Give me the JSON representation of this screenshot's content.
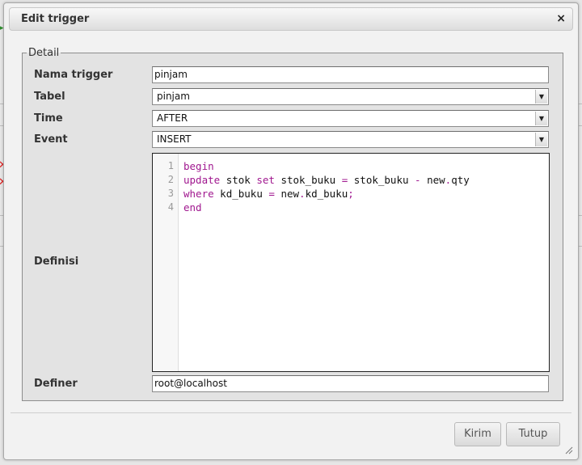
{
  "dialog": {
    "title": "Edit trigger",
    "close_symbol": "×"
  },
  "detail": {
    "legend": "Detail",
    "fields": {
      "name": {
        "label": "Nama trigger",
        "value": "pinjam"
      },
      "table": {
        "label": "Tabel",
        "value": "pinjam"
      },
      "time": {
        "label": "Time",
        "value": "AFTER"
      },
      "event": {
        "label": "Event",
        "value": "INSERT"
      },
      "definition": {
        "label": "Definisi"
      },
      "definer": {
        "label": "Definer",
        "value": "root@localhost"
      }
    }
  },
  "editor": {
    "line_numbers": [
      "1",
      "2",
      "3",
      "4"
    ],
    "lines": [
      "begin",
      "update stok set stok_buku = stok_buku - new.qty",
      "where kd_buku = new.kd_buku;",
      "end"
    ]
  },
  "buttons": {
    "submit": "Kirim",
    "close": "Tutup"
  },
  "colors": {
    "keyword": "#a0178f",
    "delete_icon": "#dd2222"
  }
}
